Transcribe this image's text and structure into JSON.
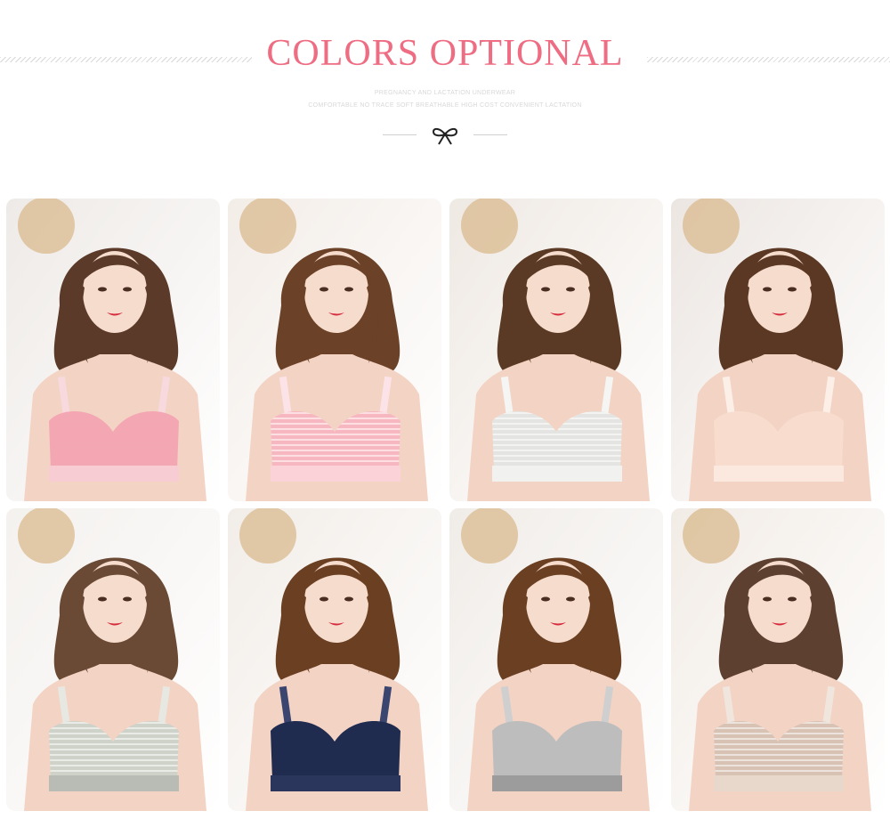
{
  "header": {
    "title": "COLORS OPTIONAL",
    "subtitle_line1": "PREGNANCY AND LACTATION UNDERWEAR",
    "subtitle_line2": "COMFORTABLE NO TRACE SOFT BREATHABLE HIGH COST CONVENIENT LACTATION",
    "bow_icon": "bow-icon"
  },
  "products": [
    {
      "color": "pink-melange",
      "bra": "#f3a7b3",
      "band": "#f7cdd3",
      "bg": "#eeeae7",
      "hair": "#5b3a2a",
      "stripes": false,
      "accent": "#f7d9de"
    },
    {
      "color": "pink-stripe",
      "bra": "#f7b7c1",
      "band": "#fbd2d8",
      "bg": "#f3ede8",
      "hair": "#6b4127",
      "stripes": true,
      "accent": "#fce3e7"
    },
    {
      "color": "grey-stripe",
      "bra": "#e4e4e2",
      "band": "#f1f1ef",
      "bg": "#efe9e3",
      "hair": "#5a3a24",
      "stripes": true,
      "accent": "#f5f5f3"
    },
    {
      "color": "nude",
      "bra": "#f8dccd",
      "band": "#fbe8de",
      "bg": "#ece6e2",
      "hair": "#5b3824",
      "stripes": false,
      "accent": "#fcefe8"
    },
    {
      "color": "green-grey-stripe",
      "bra": "#cfd2c8",
      "band": "#b9bcb4",
      "bg": "#f4f1ee",
      "hair": "#6a4a35",
      "stripes": true,
      "accent": "#e7e8e2"
    },
    {
      "color": "navy",
      "bra": "#1f2b4f",
      "band": "#2a365c",
      "bg": "#f2ede8",
      "hair": "#6b3f22",
      "stripes": false,
      "accent": "#3a4670"
    },
    {
      "color": "grey-melange",
      "bra": "#bdbdbd",
      "band": "#9c9c9c",
      "bg": "#f0ece8",
      "hair": "#6a3f22",
      "stripes": false,
      "accent": "#cfcfcf"
    },
    {
      "color": "khaki-stripe",
      "bra": "#d8c2b4",
      "band": "#e8d8cc",
      "bg": "#f2ece6",
      "hair": "#5e4030",
      "stripes": true,
      "accent": "#f0e6de"
    }
  ]
}
